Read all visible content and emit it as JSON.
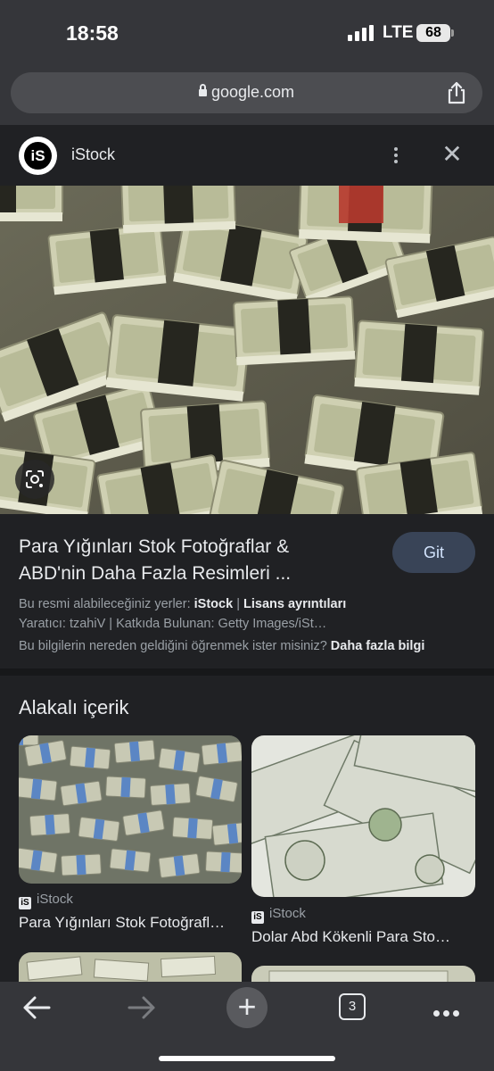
{
  "status_bar": {
    "time": "18:58",
    "network": "LTE",
    "battery": "68"
  },
  "browser": {
    "url": "google.com"
  },
  "source": {
    "name": "iStock",
    "logo_text": "iS"
  },
  "result": {
    "title_line1": "Para Yığınları Stok Fotoğraflar &",
    "title_line2": "ABD'nin Daha Fazla Resimleri ...",
    "visit_label": "Git",
    "availability_prefix": "Bu resmi alabileceğiniz yerler:",
    "availability_source": "iStock",
    "separator": "|",
    "license_link": "Lisans ayrıntıları",
    "credits": "Yaratıcı: tzahiV | Katkıda Bulunan: Getty Images/iSt…",
    "info_question": "Bu bilgilerin nereden geldiğini öğrenmek ister misiniz?",
    "info_link": "Daha fazla bilgi"
  },
  "related": {
    "heading": "Alakalı içerik",
    "items": [
      {
        "source": "iStock",
        "title": "Para Yığınları Stok Fotoğrafl…"
      },
      {
        "source": "iStock",
        "title": "Dolar Abd Kökenli Para Sto…"
      }
    ]
  },
  "bottom_bar": {
    "tab_count": "3"
  },
  "colors": {
    "background": "#202124",
    "chrome": "#35363a",
    "visit_button": "#394457",
    "money_green": "#c8c9a8"
  }
}
